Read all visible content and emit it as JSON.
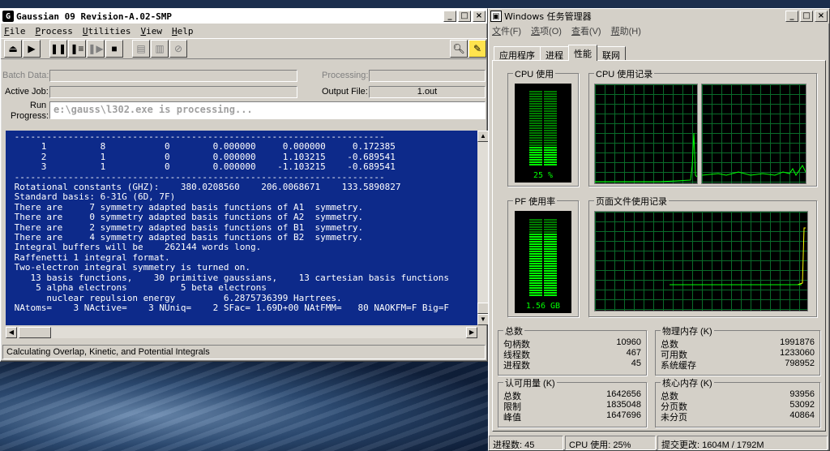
{
  "gaussian": {
    "title": "Gaussian 09 Revision-A.02-SMP",
    "menu": [
      "File",
      "Process",
      "Utilities",
      "View",
      "Help"
    ],
    "labels": {
      "batch_data": "Batch Data:",
      "active_job": "Active Job:",
      "run_progress_1": "Run",
      "run_progress_2": "Progress:",
      "processing": "Processing:",
      "output_file": "Output File:"
    },
    "output_file_value": "1.out",
    "progress_text": "e:\\gauss\\l302.exe is processing...",
    "console_lines": [
      " ---------------------------------------------------------------------",
      "      1          8           0        0.000000     0.000000     0.172385",
      "      2          1           0        0.000000     1.103215    -0.689541",
      "      3          1           0        0.000000    -1.103215    -0.689541",
      " ---------------------------------------------------------------------",
      " Rotational constants (GHZ):    380.0208560    206.0068671    133.5890827",
      " Standard basis: 6-31G (6D, 7F)",
      " There are     7 symmetry adapted basis functions of A1  symmetry.",
      " There are     0 symmetry adapted basis functions of A2  symmetry.",
      " There are     2 symmetry adapted basis functions of B1  symmetry.",
      " There are     4 symmetry adapted basis functions of B2  symmetry.",
      " Integral buffers will be    262144 words long.",
      " Raffenetti 1 integral format.",
      " Two-electron integral symmetry is turned on.",
      "    13 basis functions,    30 primitive gaussians,    13 cartesian basis functions",
      "     5 alpha electrons          5 beta electrons",
      "       nuclear repulsion energy         6.2875736399 Hartrees.",
      " NAtoms=    3 NActive=    3 NUniq=    2 SFac= 1.69D+00 NAtFMM=   80 NAOKFM=F Big=F"
    ],
    "status": "Calculating Overlap, Kinetic, and Potential Integrals"
  },
  "taskmgr": {
    "title": "Windows 任务管理器",
    "menu": [
      "文件(F)",
      "选项(O)",
      "查看(V)",
      "帮助(H)"
    ],
    "tabs": [
      "应用程序",
      "进程",
      "性能",
      "联网"
    ],
    "active_tab": 2,
    "cpu_usage_title": "CPU 使用",
    "cpu_usage_value": "25 %",
    "cpu_usage_fraction": 0.25,
    "cpu_history_title": "CPU 使用记录",
    "pf_usage_title": "PF 使用率",
    "pf_usage_value": "1.56 GB",
    "pf_usage_fraction": 0.8,
    "pf_history_title": "页面文件使用记录",
    "totals": {
      "title": "总数",
      "rows": [
        {
          "label": "句柄数",
          "value": "10960"
        },
        {
          "label": "线程数",
          "value": "467"
        },
        {
          "label": "进程数",
          "value": "45"
        }
      ]
    },
    "physical": {
      "title": "物理内存 (K)",
      "rows": [
        {
          "label": "总数",
          "value": "1991876"
        },
        {
          "label": "可用数",
          "value": "1233060"
        },
        {
          "label": "系统缓存",
          "value": "798952"
        }
      ]
    },
    "commit": {
      "title": "认可用量 (K)",
      "rows": [
        {
          "label": "总数",
          "value": "1642656"
        },
        {
          "label": "限制",
          "value": "1835048"
        },
        {
          "label": "峰值",
          "value": "1647696"
        }
      ]
    },
    "kernel": {
      "title": "核心内存 (K)",
      "rows": [
        {
          "label": "总数",
          "value": "93956"
        },
        {
          "label": "分页数",
          "value": "53092"
        },
        {
          "label": "未分页",
          "value": "40864"
        }
      ]
    },
    "status": {
      "processes": "进程数: 45",
      "cpu": "CPU 使用: 25%",
      "commit": "提交更改: 1604M / 1792M"
    },
    "colors": {
      "graph_line": "#00ff00",
      "meter_on": "#00ff00",
      "meter_off": "#007a00",
      "grid": "#0a6b2a"
    }
  }
}
